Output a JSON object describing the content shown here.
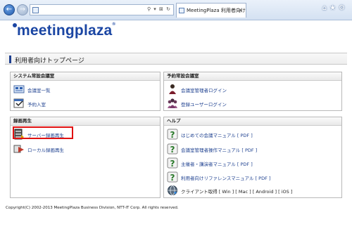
{
  "browser": {
    "tab_title": "MeetingPlaza 利用者向け...",
    "address_value": ""
  },
  "logo": "meetingplaza",
  "page_title": "利用者向けトップページ",
  "panels": {
    "system_room": {
      "heading": "システム常設会議室",
      "items": [
        "会議室一覧",
        "予約入室"
      ]
    },
    "reserved_room": {
      "heading": "予約常設会議室",
      "items": [
        "会議室管理者ログイン",
        "登録ユーザーログイン"
      ]
    },
    "recording": {
      "heading": "録画再生",
      "items": [
        "サーバー録画再生",
        "ローカル録画再生"
      ]
    },
    "help": {
      "heading": "ヘルプ",
      "items": [
        "はじめての会議マニュアル [ PDF ]",
        "会議室管理者操作マニュアル [ PDF ]",
        "主催者・講演者マニュアル [ PDF ]",
        "利用者向けリファレンスマニュアル [ PDF ]",
        "クライアント取得 [ Win ] [ Mac ] [ Android ] [ iOS ]"
      ]
    }
  },
  "footer": "Copyright(C) 2002-2013 MeetingPlaza Business Division, NTT-IT Corp. All rights reserved.",
  "colors": {
    "accent": "#1b46a3",
    "link": "#1c3f8f",
    "highlight": "#e01010"
  }
}
